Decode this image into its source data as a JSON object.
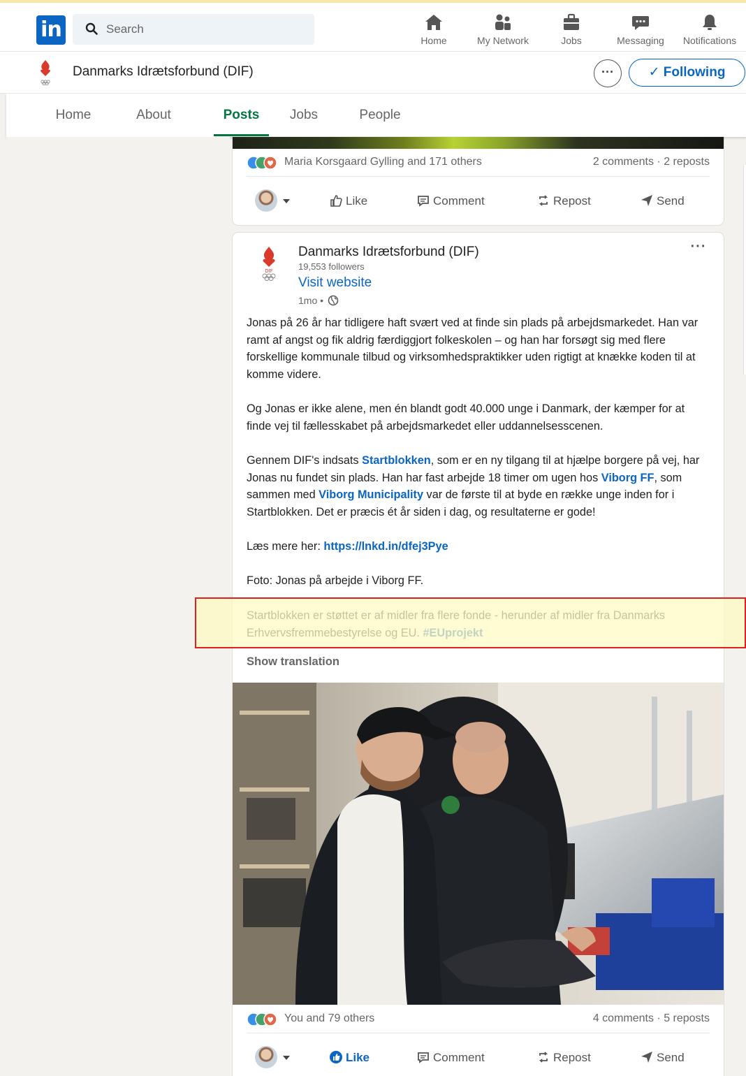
{
  "nav": {
    "search_placeholder": "Search",
    "items": [
      {
        "label": "Home",
        "icon": "home-icon"
      },
      {
        "label": "My Network",
        "icon": "network-icon"
      },
      {
        "label": "Jobs",
        "icon": "briefcase-icon"
      },
      {
        "label": "Messaging",
        "icon": "messaging-icon"
      },
      {
        "label": "Notifications",
        "icon": "bell-icon"
      }
    ]
  },
  "company": {
    "name": "Danmarks Idrætsforbund (DIF)",
    "more_label": "···",
    "following_label": "✓ Following"
  },
  "tabs": [
    {
      "label": "Home",
      "active": false
    },
    {
      "label": "About",
      "active": false
    },
    {
      "label": "Posts",
      "active": true
    },
    {
      "label": "Jobs",
      "active": false
    },
    {
      "label": "People",
      "active": false
    }
  ],
  "post1": {
    "reactions_text": "Maria Korsgaard Gylling and 171 others",
    "counts_text": "2 comments · 2 reposts",
    "actions": {
      "like": "Like",
      "comment": "Comment",
      "repost": "Repost",
      "send": "Send"
    }
  },
  "post2": {
    "author": "Danmarks Idrætsforbund (DIF)",
    "followers": "19,553 followers",
    "visit_website": "Visit website",
    "time": "1mo •",
    "menu_label": "···",
    "paragraphs": {
      "p1": "Jonas på 26 år har tidligere haft svært ved at finde sin plads på arbejdsmarkedet. Han var ramt af angst og fik aldrig færdiggjort folkeskolen – og han har forsøgt sig med flere forskellige kommunale tilbud og virksomhedspraktikker uden rigtigt at knække koden til at komme videre.",
      "p2": "Og Jonas er ikke alene, men én blandt godt 40.000 unge i Danmark, der kæmper for at finde vej til fællesskabet på arbejdsmarkedet eller uddannelsesscenen.",
      "p3_a": "Gennem DIF's indsats ",
      "p3_link1": "Startblokken",
      "p3_b": ", som er en ny tilgang til at hjælpe borgere på vej, har Jonas nu fundet sin plads. Han har fast arbejde 18 timer om ugen hos ",
      "p3_link2": "Viborg FF",
      "p3_c": ", som sammen med ",
      "p3_link3": "Viborg Municipality",
      "p3_d": " var de første til at byde en række unge inden for i Startblokken. Det er præcis ét år siden i dag, og resultaterne er gode!",
      "p4_a": "Læs mere her: ",
      "p4_link": "https://lnkd.in/dfej3Pye",
      "p5": "Foto: Jonas på arbejde i Viborg FF.",
      "p6_a": "Startblokken er støttet er af midler fra flere fonde - herunder af midler fra Danmarks Erhvervsfremmebestyrelse og EU. ",
      "p6_link": "#EUprojekt"
    },
    "show_translation": "Show translation",
    "reactions_text": "You and 79 others",
    "counts_text": "4 comments · 5 reposts",
    "actions": {
      "like": "Like",
      "comment": "Comment",
      "repost": "Repost",
      "send": "Send"
    },
    "like_active": true
  },
  "colors": {
    "linkedin_blue": "#0a66c2",
    "active_tab_green": "#057642",
    "highlight_border": "#e02020",
    "highlight_fill": "#fffac3"
  }
}
